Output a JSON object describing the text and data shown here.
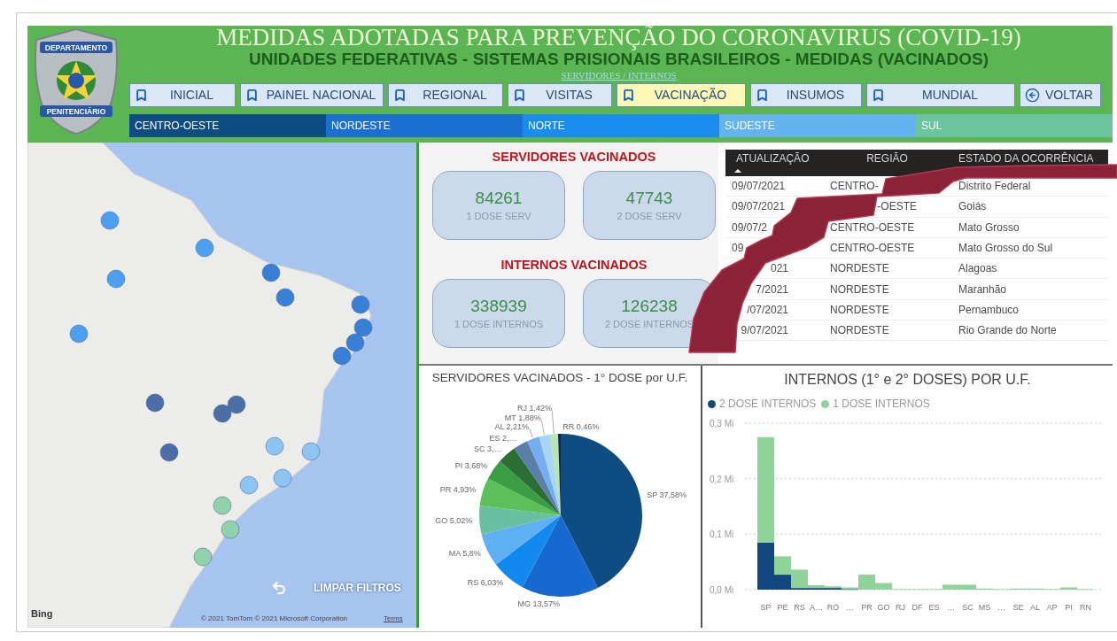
{
  "header": {
    "title": "MEDIDAS ADOTADAS PARA PREVENÇÃO DO CORONAVIRUS (COVID-19)",
    "subtitle": "UNIDADES FEDERATIVAS - SISTEMAS PRISIONAIS BRASILEIROS - MEDIDAS (VACINADOS)",
    "section_link": "SERVIDORES / INTERNOS",
    "logo": {
      "top_text": "DEPARTAMENTO",
      "bottom_text": "PENITENCIÁRIO"
    }
  },
  "nav": [
    {
      "label": "INICIAL",
      "kind": "bookmark",
      "selected": false
    },
    {
      "label": "PAINEL NACIONAL",
      "kind": "bookmark",
      "selected": false
    },
    {
      "label": "REGIONAL",
      "kind": "bookmark",
      "selected": false
    },
    {
      "label": "VISITAS",
      "kind": "bookmark",
      "selected": false
    },
    {
      "label": "VACINAÇÃO",
      "kind": "bookmark",
      "selected": true
    },
    {
      "label": "INSUMOS",
      "kind": "bookmark",
      "selected": false
    },
    {
      "label": "MUNDIAL",
      "kind": "bookmark",
      "selected": false
    },
    {
      "label": "VOLTAR",
      "kind": "back",
      "selected": false
    }
  ],
  "regions": [
    {
      "label": "CENTRO-OESTE",
      "color": "#0f4c81"
    },
    {
      "label": "NORDESTE",
      "color": "#1b6fd1"
    },
    {
      "label": "NORTE",
      "color": "#1a8cf0"
    },
    {
      "label": "SUDESTE",
      "color": "#63b3ee"
    },
    {
      "label": "SUL",
      "color": "#6cc3a0"
    }
  ],
  "map": {
    "provider": "Bing",
    "clear_filters": "LIMPAR FILTROS",
    "attribution": "© 2021 TomTom  © 2021 Microsoft Corporation",
    "terms": "Terms"
  },
  "kpis": [
    {
      "title": "SERVIDORES VACINADOS",
      "cards": [
        {
          "value": "84261",
          "label": "1 DOSE SERV"
        },
        {
          "value": "47743",
          "label": "2 DOSE SERV"
        }
      ]
    },
    {
      "title": "INTERNOS VACINADOS",
      "cards": [
        {
          "value": "338939",
          "label": "1 DOSE INTERNOS"
        },
        {
          "value": "126238",
          "label": "2 DOSE INTERNOS"
        }
      ]
    }
  ],
  "table": {
    "columns": [
      {
        "label": "ATUALIZAÇÃO",
        "sorted": true
      },
      {
        "label": "REGIÃO",
        "sorted": false
      },
      {
        "label": "ESTADO DA OCORRÊNCIA",
        "sorted": false
      }
    ],
    "rows": [
      [
        {
          "text": "09/07/2021",
          "clipped_left": false
        },
        {
          "text": "CENTRO-",
          "clipped_left": false
        },
        {
          "text": "Distrito Federal",
          "clipped_left": false
        }
      ],
      [
        {
          "text": "09/07/2021",
          "clipped_left": false
        },
        {
          "text": "-OESTE",
          "clipped_left": true
        },
        {
          "text": "Goiás",
          "clipped_left": false
        }
      ],
      [
        {
          "text": "09/07/2",
          "clipped_left": false
        },
        {
          "text": "CENTRO-OESTE",
          "clipped_left": false
        },
        {
          "text": "Mato Grosso",
          "clipped_left": false
        }
      ],
      [
        {
          "text": "09",
          "clipped_left": false
        },
        {
          "text": "CENTRO-OESTE",
          "clipped_left": false
        },
        {
          "text": "Mato Grosso do Sul",
          "clipped_left": false
        }
      ],
      [
        {
          "text": "021",
          "clipped_left": true
        },
        {
          "text": "NORDESTE",
          "clipped_left": false
        },
        {
          "text": "Alagoas",
          "clipped_left": false
        }
      ],
      [
        {
          "text": "7/2021",
          "clipped_left": true
        },
        {
          "text": "NORDESTE",
          "clipped_left": false
        },
        {
          "text": "Maranhão",
          "clipped_left": false
        }
      ],
      [
        {
          "text": "/07/2021",
          "clipped_left": true
        },
        {
          "text": "NORDESTE",
          "clipped_left": false
        },
        {
          "text": "Pernambuco",
          "clipped_left": false
        }
      ],
      [
        {
          "text": "9/07/2021",
          "clipped_left": true
        },
        {
          "text": "NORDESTE",
          "clipped_left": false
        },
        {
          "text": "Rio Grande do Norte",
          "clipped_left": false
        }
      ]
    ]
  },
  "pie": {
    "chart_data": {
      "type": "pie",
      "title": "SERVIDORES VACINADOS - 1° DOSE por U.F.",
      "categories": [
        "SP",
        "MG",
        "RS",
        "MA",
        "GO",
        "PR",
        "PI",
        "SC",
        "ES",
        "AL",
        "MT",
        "RJ",
        "RR"
      ],
      "values": [
        37.58,
        13.57,
        6.03,
        5.8,
        5.02,
        4.93,
        3.68,
        3.3,
        2.6,
        2.21,
        1.88,
        1.42,
        0.46
      ],
      "value_labels": [
        "37,58%",
        "13,57%",
        "6,03%",
        "5,8%",
        "5,02%",
        "4,93%",
        "3,68%",
        "3,…",
        "2,…",
        "2,21%",
        "1,88%",
        "1,42%",
        "0,46%"
      ]
    }
  },
  "bars": {
    "chart_data": {
      "type": "bar",
      "title": "INTERNOS (1° e 2° DOSES) POR U.F.",
      "stacked": true,
      "legend": "top-left",
      "categories": [
        "SP",
        "PE",
        "RS",
        "A…",
        "RO",
        "…",
        "PR",
        "GO",
        "RJ",
        "DF",
        "ES",
        "…",
        "SC",
        "MS",
        "…",
        "SE",
        "AL",
        "AP",
        "PI",
        "RN"
      ],
      "series": [
        {
          "name": "2 DOSE INTERNOS",
          "color": "#12467f",
          "values": [
            0.085,
            0.027,
            0.003,
            0.003,
            0.003,
            0.001,
            0,
            0,
            0,
            0,
            0,
            0,
            0,
            0,
            0,
            0,
            0,
            0,
            0,
            0
          ]
        },
        {
          "name": "1 DOSE INTERNOS",
          "color": "#8fd39a",
          "values": [
            0.19,
            0.033,
            0.033,
            0.005,
            0.003,
            0.003,
            0.027,
            0.012,
            0.001,
            0.001,
            0.001,
            0.009,
            0.009,
            0.002,
            0.001,
            0.002,
            0.002,
            0.001,
            0.004,
            0.001
          ]
        }
      ],
      "ylim": [
        0,
        0.3
      ],
      "yticks": [
        {
          "value": 0,
          "label": "0,0 Mi"
        },
        {
          "value": 0.1,
          "label": "0,1 Mi"
        },
        {
          "value": 0.2,
          "label": "0,2 Mi"
        },
        {
          "value": 0.3,
          "label": "0,3 Mi"
        }
      ]
    }
  }
}
